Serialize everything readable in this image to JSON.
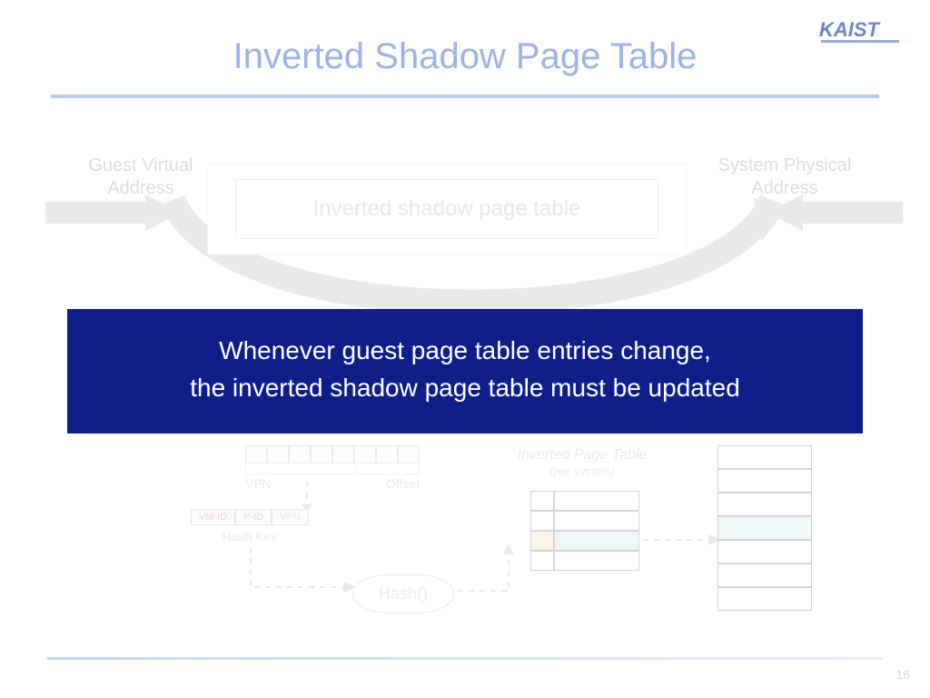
{
  "title": "Inverted Shadow Page Table",
  "logo": "KAIST",
  "page_number": "16",
  "labels": {
    "guest_virtual_address": "Guest Virtual\nAddress",
    "system_physical_address": "System Physical\nAddress",
    "box_center": "Inverted shadow page table",
    "vpn": "VPN",
    "offset": "Offset",
    "hash_key": "Hash Key",
    "hash_fn": "Hash()",
    "inverted_page_table": "Inverted Page Table",
    "per_system": "(per system)",
    "vm_id": "VM-ID",
    "p_id": "P-ID",
    "vpn_chip": "VPN"
  },
  "banner": {
    "line1": "Whenever guest page table entries change,",
    "line2": "the inverted shadow page table must be updated"
  }
}
